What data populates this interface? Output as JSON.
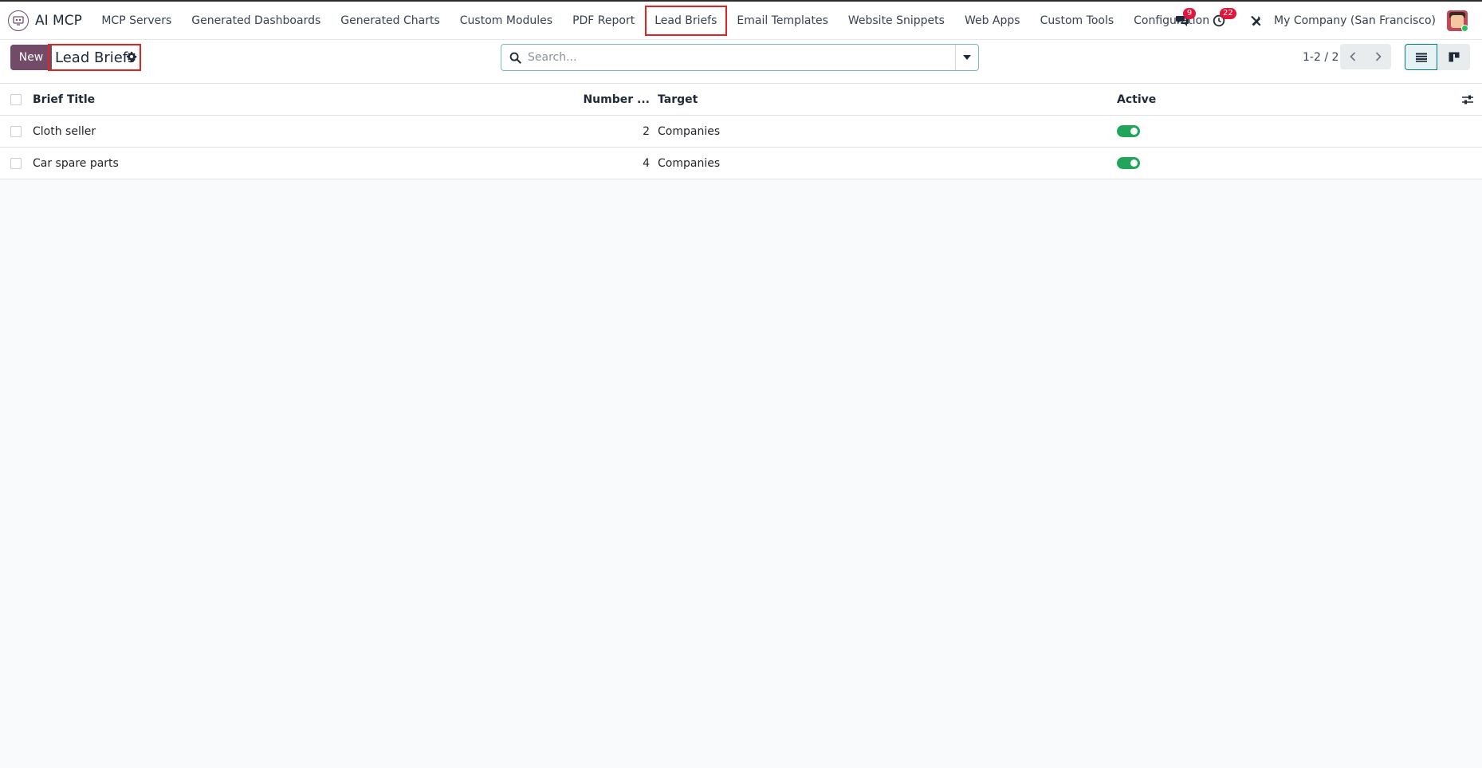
{
  "navbar": {
    "app_name": "AI MCP",
    "menu": [
      {
        "label": "MCP Servers"
      },
      {
        "label": "Generated Dashboards"
      },
      {
        "label": "Generated Charts"
      },
      {
        "label": "Custom Modules"
      },
      {
        "label": "PDF Report"
      },
      {
        "label": "Lead Briefs"
      },
      {
        "label": "Email Templates"
      },
      {
        "label": "Website Snippets"
      },
      {
        "label": "Web Apps"
      },
      {
        "label": "Custom Tools"
      },
      {
        "label": "Configuration"
      }
    ],
    "messages_count": "9",
    "activities_count": "22",
    "company": "My Company (San Francisco)"
  },
  "control": {
    "new_label": "New",
    "title": "Lead Briefs",
    "search_placeholder": "Search...",
    "pager": "1-2 / 2"
  },
  "list": {
    "columns": {
      "title": "Brief Title",
      "number": "Number ...",
      "target": "Target",
      "active": "Active"
    },
    "rows": [
      {
        "title": "Cloth seller",
        "number": "2",
        "target": "Companies",
        "active": true
      },
      {
        "title": "Car spare parts",
        "number": "4",
        "target": "Companies",
        "active": true
      }
    ]
  },
  "colors": {
    "brand": "#714b67",
    "accent": "#017e84",
    "toggle_on": "#21a55b",
    "badge": "#e0163a"
  }
}
